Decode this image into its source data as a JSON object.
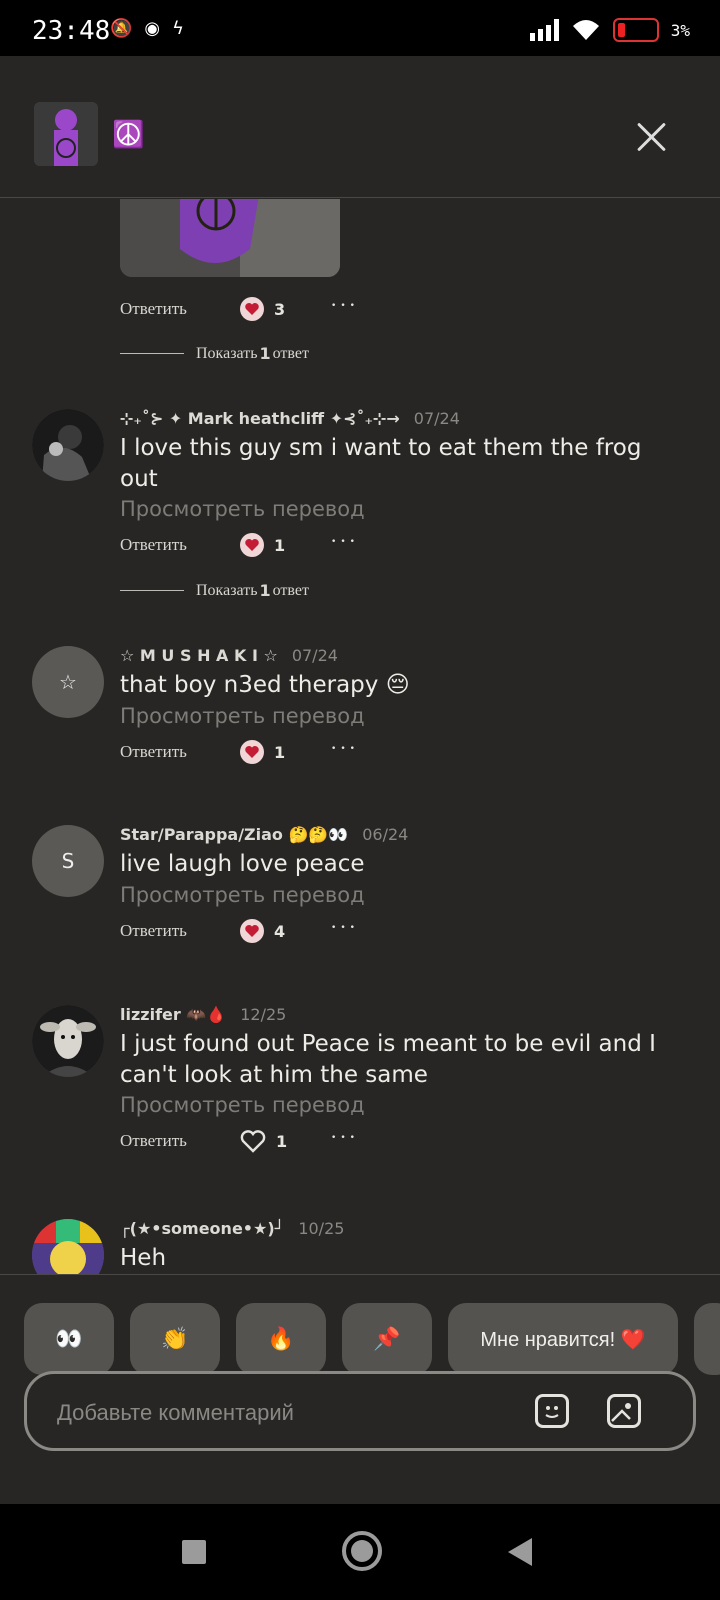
{
  "status_bar": {
    "time": "23:48",
    "battery_pct": "3",
    "icons_left": [
      "mute-icon",
      "vk-icon",
      "flash-icon"
    ],
    "icons_right": [
      "signal-icon",
      "wifi-icon",
      "battery-icon"
    ]
  },
  "header": {
    "emoji": "☮️",
    "close_icon": "close-icon"
  },
  "first_comment": {
    "reply": "Ответить",
    "likes": "3",
    "show_replies_prefix": "Показать",
    "show_replies_count": "1",
    "show_replies_suffix": "ответ"
  },
  "comments": [
    {
      "username": "⊹₊˚⊱ ✦ Mark heathcliff ✦⊰˚₊⊹→",
      "date": "07/24",
      "text": "I love this guy sm i want to eat them the frog out",
      "translate": "Просмотреть перевод",
      "reply": "Ответить",
      "likes": "1",
      "show_replies_prefix": "Показать",
      "show_replies_count": "1",
      "show_replies_suffix": "ответ"
    },
    {
      "username": "☆ M U S H A K I ☆",
      "date": "07/24",
      "text": "that boy n3ed therapy 😔",
      "translate": "Просмотреть перевод",
      "reply": "Ответить",
      "likes": "1",
      "avatar_glyph": "☆"
    },
    {
      "username": "Star/Parappa/Ziao 🤔🤔👀",
      "date": "06/24",
      "text": "live laugh love peace",
      "translate": "Просмотреть перевод",
      "reply": "Ответить",
      "likes": "4",
      "avatar_glyph": "S"
    },
    {
      "username": "lizzifer 🦇🩸",
      "date": "12/25",
      "text": "I just found out Peace is meant to be evil and I can't look at him the same",
      "translate": "Просмотреть перевод",
      "reply": "Ответить",
      "likes": "1"
    },
    {
      "username": "┌(★•someone•★)┘",
      "date": "10/25",
      "text": "Heh"
    }
  ],
  "reactions": [
    "👀",
    "👏",
    "🔥",
    "📌",
    "Мне нравится! ❤️"
  ],
  "comment_box": {
    "placeholder": "Добавьте комментарий",
    "sticker_icon": "sticker-icon",
    "image_icon": "image-icon"
  },
  "colors": {
    "background": "#272624",
    "like_heart": "#c21d34",
    "reaction_chip": "#55534f"
  }
}
